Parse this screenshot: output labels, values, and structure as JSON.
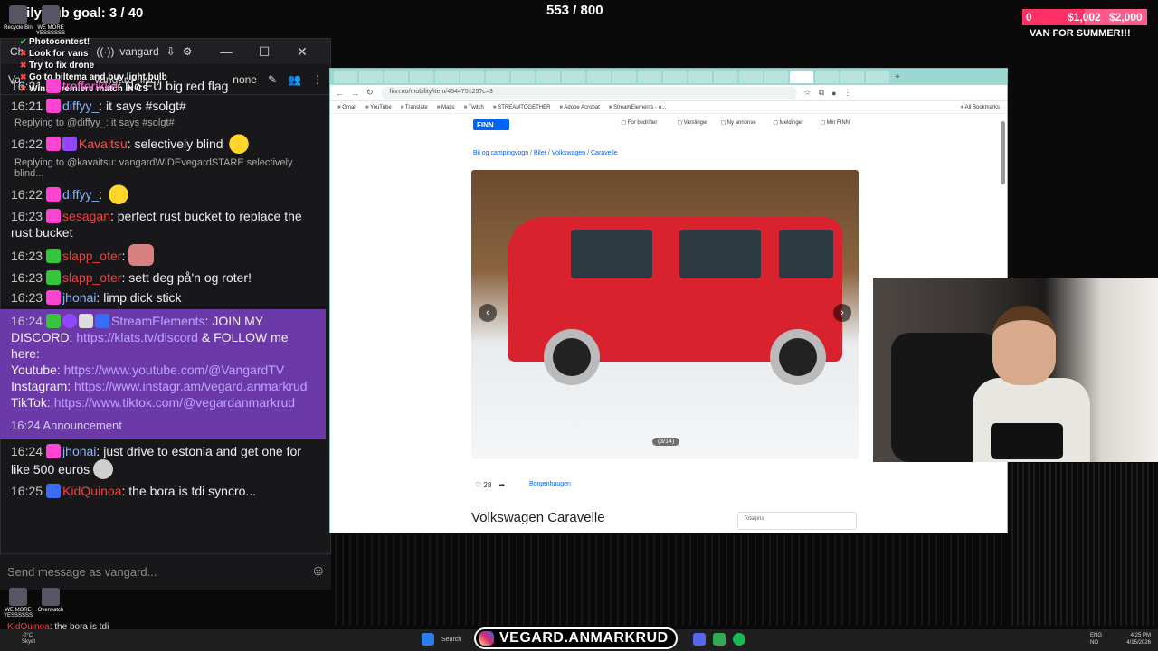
{
  "overlay": {
    "sub_goal": "Daily sub goal: 3 / 40",
    "counter": "553 / 800",
    "goal_current": "$1,002",
    "goal_target": "$2,000",
    "goal_left": "0",
    "goal_fraction": 0.501,
    "goal_text": "VAN FOR SUMMER!!!"
  },
  "desktop": {
    "icons": [
      {
        "label": "Recycle Bin"
      },
      {
        "label": "WE MORE YESSSSSS"
      }
    ],
    "bottom_icons": [
      {
        "label": "WE MORE YESSSSSS"
      },
      {
        "label": "Overwatch"
      }
    ]
  },
  "todo": [
    {
      "mark": "✔",
      "text": "Photocontest!"
    },
    {
      "mark": "✖",
      "text": "Look for vans"
    },
    {
      "mark": "✖",
      "text": "Try to fix drone"
    },
    {
      "mark": "✖",
      "text": "Go to biltema and buy light bulb"
    },
    {
      "mark": "✖",
      "text": "Win a premiere match in CS"
    }
  ],
  "chat": {
    "title_prefix": "Ch",
    "window_user": "vangard",
    "header_title": "Vangard (live)",
    "header_left": "Va",
    "header_filter": "none",
    "input_placeholder": "Send message as vangard...",
    "messages": [
      {
        "time": "16:21",
        "badges": [
          "sub"
        ],
        "user": "trefferikke",
        "color": "#ff6ad5",
        "text": "No EU big red flag"
      },
      {
        "time": "16:21",
        "badges": [
          "sub"
        ],
        "user": "diffyy_",
        "color": "#8ab4ff",
        "text": "it says #solgt#"
      },
      {
        "reply": "Replying to @diffyy_: it says #solgt#"
      },
      {
        "time": "16:22",
        "badges": [
          "sub",
          "prime"
        ],
        "user": "Kavaitsu",
        "color": "#ff4f4f",
        "text": "selectively blind",
        "emote": "duck"
      },
      {
        "reply": "Replying to @kavaitsu: vangardWIDEvegardSTARE selectively blind..."
      },
      {
        "time": "16:22",
        "badges": [
          "sub"
        ],
        "user": "diffyy_",
        "color": "#8ab4ff",
        "text": "",
        "emote": "duck"
      },
      {
        "time": "16:23",
        "badges": [
          "sub"
        ],
        "user": "sesagan",
        "color": "#ff3a3a",
        "text": "perfect rust bucket to replace the rust bucket"
      },
      {
        "time": "16:23",
        "badges": [
          "green"
        ],
        "user": "slapp_oter",
        "color": "#ff3a3a",
        "text": "",
        "emote": "lips"
      },
      {
        "time": "16:23",
        "badges": [
          "green"
        ],
        "user": "slapp_oter",
        "color": "#ff3a3a",
        "text": "sett deg på'n og roter!"
      },
      {
        "time": "16:23",
        "badges": [
          "sub"
        ],
        "user": "jhonai",
        "color": "#8ab4ff",
        "text": "limp dick stick"
      }
    ],
    "announcement": {
      "time": "16:24",
      "user": "StreamElements",
      "lead": "JOIN MY DISCORD:",
      "discord": "https://klats.tv/discord",
      "mid": "& FOLLOW me here:",
      "youtube_label": "Youtube:",
      "youtube": "https://www.youtube.com/@VangardTV",
      "instagram_label": "Instagram:",
      "instagram": "https://www.instagr.am/vegard.anmarkrud",
      "tiktok_label": "TikTok:",
      "tiktok": "https://www.tiktok.com/@vegardanmarkrud",
      "footer": "16:24 Announcement"
    },
    "messages_after": [
      {
        "time": "16:24",
        "badges": [
          "sub"
        ],
        "user": "jhonai",
        "color": "#8ab4ff",
        "text": "just drive to estonia and get one for like 500 euros",
        "emote": "gray"
      },
      {
        "time": "16:25",
        "badges": [
          "blue"
        ],
        "user": "KidQuinoa",
        "color": "#ff3a3a",
        "text": "the bora is tdi syncro..."
      }
    ]
  },
  "browser": {
    "url": "finn.no/mobility/item/454475125?c=3",
    "bookmarks": [
      "Gmail",
      "YouTube",
      "Translate",
      "Maps",
      "Twitch",
      "STREAMTOGETHER",
      "Adobe Acrobat",
      "StreamElements - o...",
      "All Bookmarks"
    ],
    "logo": "FINN",
    "nav": [
      "For bedrifter",
      "Varslinger",
      "Ny annonse",
      "Meldinger",
      "Min FINN"
    ],
    "breadcrumb": [
      "Bil og campingvogn",
      "Biler",
      "Volkswagen",
      "Caravelle"
    ],
    "photo_counter": "(3/14)",
    "likes": "28",
    "location": "Borgenhaugen",
    "title": "Volkswagen Caravelle",
    "side_box": "Totalpris"
  },
  "bottom": {
    "ghost_user": "KidQuinoa",
    "ghost_text": "the bora is tdi",
    "weather_temp": "-0°C",
    "weather_desc": "Skyet",
    "search": "Search",
    "handle": "VEGARD.ANMARKRUD",
    "lang1": "ENG",
    "lang2": "NO",
    "time": "4:25 PM",
    "date": "4/15/2026"
  }
}
